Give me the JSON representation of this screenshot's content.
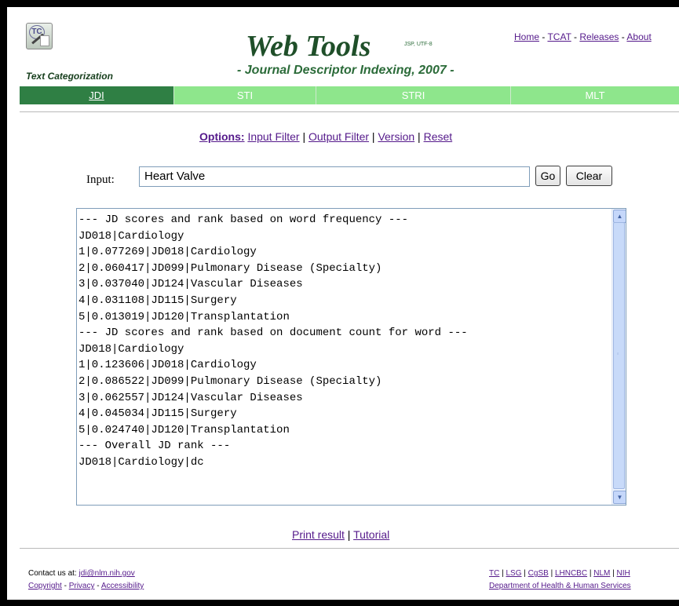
{
  "header": {
    "app_name": "Text Categorization",
    "title": "Web Tools",
    "title_info": "JSP, UTF-8",
    "subtitle": "- Journal Descriptor Indexing, 2007 -",
    "links": [
      "Home",
      "TCAT",
      "Releases",
      "About"
    ]
  },
  "tabs": [
    {
      "label": "JDI",
      "active": true
    },
    {
      "label": "STI",
      "active": false
    },
    {
      "label": "STRI",
      "active": false
    },
    {
      "label": "MLT",
      "active": false
    }
  ],
  "options": {
    "label": "Options:",
    "items": [
      "Input Filter",
      "Output Filter",
      "Version",
      "Reset"
    ]
  },
  "input": {
    "label": "Input:",
    "value": "Heart Valve",
    "go_label": "Go",
    "clear_label": "Clear"
  },
  "results": [
    "--- JD scores and rank based on word frequency ---",
    "JD018|Cardiology",
    "1|0.077269|JD018|Cardiology",
    "2|0.060417|JD099|Pulmonary Disease (Specialty)",
    "3|0.037040|JD124|Vascular Diseases",
    "4|0.031108|JD115|Surgery",
    "5|0.013019|JD120|Transplantation",
    "--- JD scores and rank based on document count for word ---",
    "JD018|Cardiology",
    "1|0.123606|JD018|Cardiology",
    "2|0.086522|JD099|Pulmonary Disease (Specialty)",
    "3|0.062557|JD124|Vascular Diseases",
    "4|0.045034|JD115|Surgery",
    "5|0.024740|JD120|Transplantation",
    "--- Overall JD rank ---",
    "JD018|Cardiology|dc"
  ],
  "bottom_links": {
    "print": "Print result",
    "tutorial": "Tutorial"
  },
  "footer": {
    "contact_prefix": "Contact us at:",
    "contact_email": "jdi@nlm.nih.gov",
    "copyright": "Copyright",
    "privacy": "Privacy",
    "accessibility": "Accessibility",
    "orgs": [
      "TC",
      "LSG",
      "CgSB",
      "LHNCBC",
      "NLM",
      "NIH"
    ],
    "dept": "Department of Health & Human Services"
  },
  "colors": {
    "tab_active": "#2f7f44",
    "tab_inactive": "#8ee68c",
    "title": "#1f4f29",
    "link": "#551a8b"
  }
}
